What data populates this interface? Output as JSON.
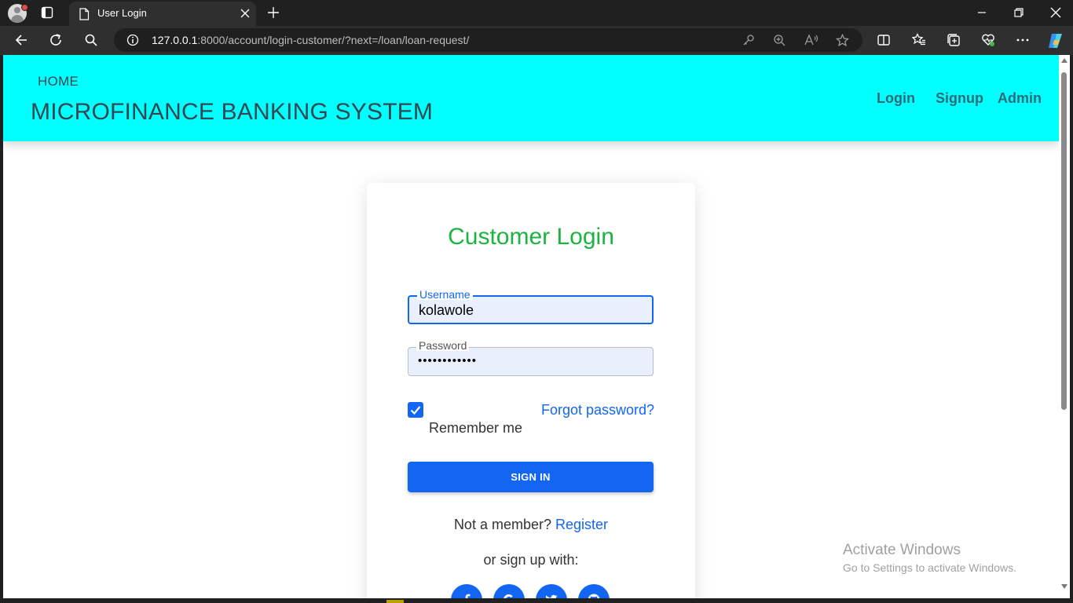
{
  "browser": {
    "tab_title": "User Login",
    "url_host": "127.0.0.1",
    "url_rest": ":8000/account/login-customer/?next=/loan/loan-request/"
  },
  "navbar": {
    "home": "HOME",
    "brand": "MICROFINANCE BANKING SYSTEM",
    "links": [
      "Login",
      "Signup",
      "Admin"
    ],
    "bg_color": "#00ffff"
  },
  "form": {
    "title": "Customer Login",
    "username_label": "Username",
    "username_value": "kolawole",
    "password_label": "Password",
    "password_value": "••••••••••••",
    "remember_label": "Remember me",
    "remember_checked": true,
    "forgot_label": "Forgot password?",
    "signin_label": "SIGN IN",
    "not_member": "Not a member?",
    "register_label": "Register",
    "or_signup": "or sign up with:",
    "social_icons": [
      "facebook-icon",
      "google-icon",
      "twitter-icon",
      "github-icon"
    ],
    "accent_color": "#1266f1",
    "title_color": "#1bb341"
  },
  "watermark": {
    "line1": "Activate Windows",
    "line2": "Go to Settings to activate Windows."
  }
}
